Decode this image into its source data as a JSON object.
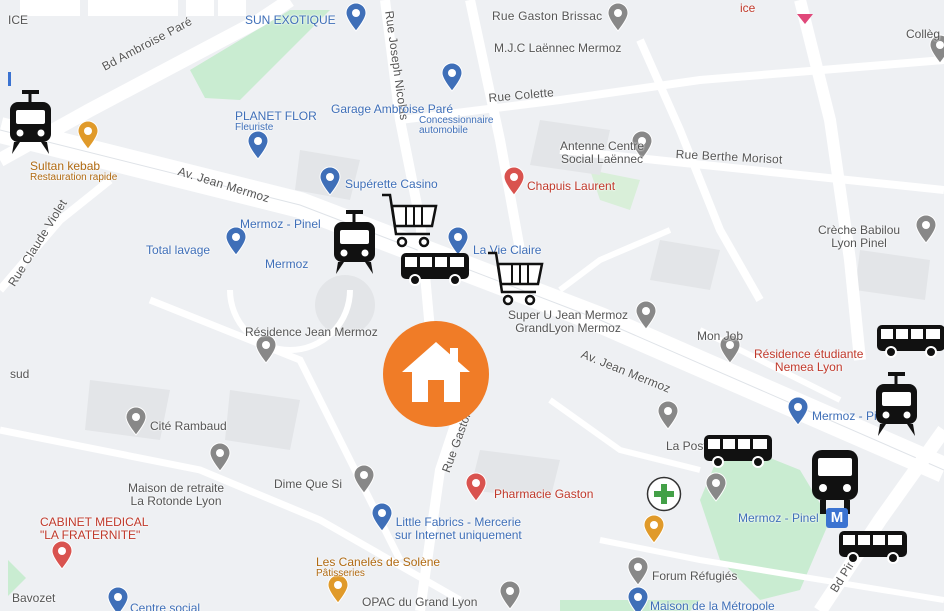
{
  "map": {
    "road_labels": [
      {
        "id": "bd-ambroise-pare",
        "text": "Bd Ambroise Paré"
      },
      {
        "id": "av-jean-mermoz-west",
        "text": "Av. Jean Mermoz"
      },
      {
        "id": "av-jean-mermoz-east",
        "text": "Av. Jean Mermoz"
      },
      {
        "id": "rue-gaston-brissac",
        "text": "Rue Gaston Brissac"
      },
      {
        "id": "rue-colette",
        "text": "Rue Colette"
      },
      {
        "id": "rue-berthe-morisot",
        "text": "Rue Berthe Morisot"
      },
      {
        "id": "rue-claude-violet",
        "text": "Rue Claude Violet"
      },
      {
        "id": "rue-gaston-vertical",
        "text": "Rue Gaston"
      },
      {
        "id": "rue-joseph-nicolas",
        "text": "Rue Joseph Nicolas"
      },
      {
        "id": "bd-pinel",
        "text": "Bd Pinel"
      }
    ],
    "poi_labels": [
      {
        "id": "sun-exotique",
        "text": "SUN EXOTIQUE",
        "style": "blue"
      },
      {
        "id": "mjc",
        "text": "M.J.C Laënnec Mermoz",
        "style": "gray"
      },
      {
        "id": "college",
        "text": "Collèg",
        "style": "gray"
      },
      {
        "id": "planet-flor",
        "text": "PLANET FLOR",
        "sub": "Fleuriste",
        "style": "blue"
      },
      {
        "id": "garage",
        "text": "Garage Ambroise Paré",
        "sub": "Concessionnaire automobile",
        "style": "blue"
      },
      {
        "id": "antenne",
        "text": "Antenne Centre",
        "sub2": "Social Laënnec",
        "style": "gray"
      },
      {
        "id": "sultan",
        "text": "Sultan kebab",
        "sub": "Restauration rapide",
        "style": "orange"
      },
      {
        "id": "casino",
        "text": "Supérette Casino",
        "style": "blue"
      },
      {
        "id": "chapuis",
        "text": "Chapuis Laurent",
        "style": "red"
      },
      {
        "id": "mermoz1",
        "text": "Mermoz - Pinel",
        "style": "blue"
      },
      {
        "id": "creche",
        "text": "Crèche Babilou",
        "sub2": "Lyon Pinel",
        "style": "gray"
      },
      {
        "id": "total",
        "text": "Total lavage",
        "style": "blue"
      },
      {
        "id": "mermoz2",
        "text": "Mermoz",
        "style": "blue"
      },
      {
        "id": "vie-claire",
        "text": "La Vie Claire",
        "style": "blue"
      },
      {
        "id": "residence",
        "text": "Résidence Jean Mermoz",
        "style": "gray"
      },
      {
        "id": "super-u",
        "text": "Super U Jean Mermoz",
        "sub2": "GrandLyon Mermoz",
        "style": "gray"
      },
      {
        "id": "mon-job",
        "text": "Mon Job",
        "style": "gray"
      },
      {
        "id": "residence-etu",
        "text": "Résidence étudiante",
        "sub2": "Nemea Lyon",
        "style": "red"
      },
      {
        "id": "sud",
        "text": "sud",
        "style": "gray"
      },
      {
        "id": "cite-rambaud",
        "text": "Cité Rambaud",
        "style": "gray"
      },
      {
        "id": "mermoz3",
        "text": "Mermoz - Pinel",
        "style": "blue"
      },
      {
        "id": "la-poste",
        "text": "La Poste",
        "style": "gray"
      },
      {
        "id": "maison-retraite",
        "text": "Maison de retraite",
        "sub2": "La Rotonde Lyon",
        "style": "gray"
      },
      {
        "id": "dime",
        "text": "Dime Que Si",
        "style": "gray"
      },
      {
        "id": "pharmacie",
        "text": "Pharmacie Gaston",
        "style": "red"
      },
      {
        "id": "mermoz-pinel-m",
        "text": "Mermoz - Pinel",
        "style": "blue"
      },
      {
        "id": "cabinet",
        "text": "CABINET MEDICAL",
        "sub2": "\"LA FRATERNITE\"",
        "style": "red"
      },
      {
        "id": "little-fabrics",
        "text": "Little Fabrics - Mercerie",
        "sub2": "sur Internet uniquement",
        "style": "blue"
      },
      {
        "id": "canneles",
        "text": "Les Canelés de Solène",
        "sub": "Pâtisseries",
        "style": "orange"
      },
      {
        "id": "forum",
        "text": "Forum Réfugiés",
        "style": "gray"
      },
      {
        "id": "bavozet",
        "text": "Bavozet",
        "style": "gray"
      },
      {
        "id": "centre-social",
        "text": "Centre social",
        "style": "blue"
      },
      {
        "id": "opac",
        "text": "OPAC du Grand Lyon",
        "style": "gray"
      },
      {
        "id": "maison-metropole",
        "text": "Maison de la Métropole",
        "style": "blue"
      },
      {
        "id": "ice",
        "text": "ICE",
        "style": "gray"
      },
      {
        "id": "top-red",
        "text": "ice",
        "style": "red"
      }
    ],
    "colors": {
      "background": "#eef0f3",
      "road": "#ffffff",
      "park": "#c9ecd1",
      "home_marker": "#f07c27",
      "poi_blue": "#3f6fb8",
      "poi_red": "#c0392b",
      "poi_orange": "#b06a12"
    },
    "overlay_icons": [
      {
        "id": "home-marker",
        "icon": "home-icon"
      },
      {
        "id": "tram-1",
        "icon": "tram-icon"
      },
      {
        "id": "tram-2",
        "icon": "tram-icon"
      },
      {
        "id": "tram-3",
        "icon": "tram-icon"
      },
      {
        "id": "train-1",
        "icon": "train-icon"
      },
      {
        "id": "cart-1",
        "icon": "shopping-cart-icon"
      },
      {
        "id": "cart-2",
        "icon": "shopping-cart-icon"
      },
      {
        "id": "bus-1",
        "icon": "bus-icon"
      },
      {
        "id": "bus-2",
        "icon": "bus-icon"
      },
      {
        "id": "bus-3",
        "icon": "bus-icon"
      },
      {
        "id": "bus-4",
        "icon": "bus-icon"
      },
      {
        "id": "pharmacy-1",
        "icon": "pharmacy-cross-icon"
      }
    ],
    "metro_badge": "M"
  }
}
